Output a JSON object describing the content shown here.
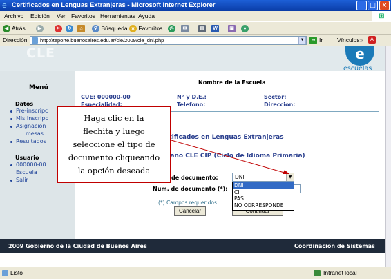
{
  "window": {
    "title": "Certificados en Lenguas Extranjeras - Microsoft Internet Explorer"
  },
  "menubar": {
    "items": [
      "Archivo",
      "Edición",
      "Ver",
      "Favoritos",
      "Herramientas",
      "Ayuda"
    ]
  },
  "toolbar": {
    "back_label": "Atrás",
    "search_label": "Búsqueda",
    "favorites_label": "Favoritos"
  },
  "addressbar": {
    "label": "Dirección",
    "url": "http://teporte.buenosaires.edu.ar/cle/2009/cle_dni.php",
    "go_label": "Ir",
    "links_label": "Vínculos"
  },
  "header": {
    "app_name": "CLE",
    "logo_letter": "e",
    "logo_text": "escuelas"
  },
  "sidebar": {
    "title": "Menú",
    "datos_heading": "Datos",
    "datos_items": [
      "Pre-inscripc",
      "Mis Inscripc",
      "Asignación",
      "mesas",
      "Resultados"
    ],
    "usuario_heading": "Usuario",
    "usuario_items": [
      "000000-00",
      "Escuela",
      "Salir"
    ]
  },
  "school": {
    "name": "Nombre de la Escuela",
    "cue": "CUE: 000000-00",
    "especialidad": "Especialidad:",
    "numero_de": "N° y D.E.:",
    "telefono": "Telefono:",
    "sector": "Sector:",
    "direccion": "Direccion:"
  },
  "form": {
    "section_title": "rtificados en Lenguas Extranjeras",
    "subsection_title": "uano CLE CIP (Ciclo de Idioma Primaria)",
    "tipo_label": "de documento:",
    "num_label": "Num. de documento (*):",
    "tipo_selected": "DNI",
    "tipo_options": [
      "DNI",
      "CI",
      "PAS",
      "NO CORRESPONDE"
    ],
    "required_note": "(*) Campos requeridos",
    "cancel_label": "Cancelar",
    "continue_label": "Continuar"
  },
  "callout": {
    "lines": [
      "Haga clic en la",
      "flechita y luego",
      "seleccione el tipo de",
      "documento cliqueando",
      "la opción deseada"
    ]
  },
  "footer": {
    "left": "2009 Gobierno de la Ciudad de Buenos Aires",
    "right": "Coordinación de Sistemas"
  },
  "statusbar": {
    "status": "Listo",
    "zone": "Intranet local"
  }
}
